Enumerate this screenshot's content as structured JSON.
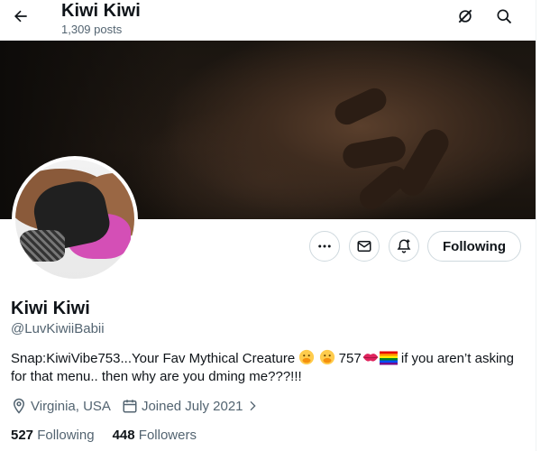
{
  "header": {
    "title": "Kiwi Kiwi",
    "post_count": "1,309 posts"
  },
  "profile": {
    "display_name": "Kiwi Kiwi",
    "handle": "@LuvKiwiiBabii",
    "bio_part1": "Snap:KiwiVibe753...Your Fav Mythical Creature ",
    "bio_part2": " 757",
    "bio_part3": " if you aren’t asking for that menu.. then why are you dming me???!!!",
    "location": "Virginia, USA",
    "joined": "Joined July 2021",
    "following_count": "527",
    "following_label": "Following",
    "followers_count": "448",
    "followers_label": "Followers"
  },
  "actions": {
    "follow_button_label": "Following"
  },
  "icons": {
    "back": "arrow-left-icon",
    "grok": "grok-icon",
    "search": "search-icon",
    "more": "more-icon",
    "message": "message-icon",
    "notify": "notification-bell-icon",
    "location": "location-pin-icon",
    "calendar": "calendar-icon"
  },
  "colors": {
    "text": "#0f1419",
    "secondary": "#536471",
    "border": "#cfd9de"
  }
}
